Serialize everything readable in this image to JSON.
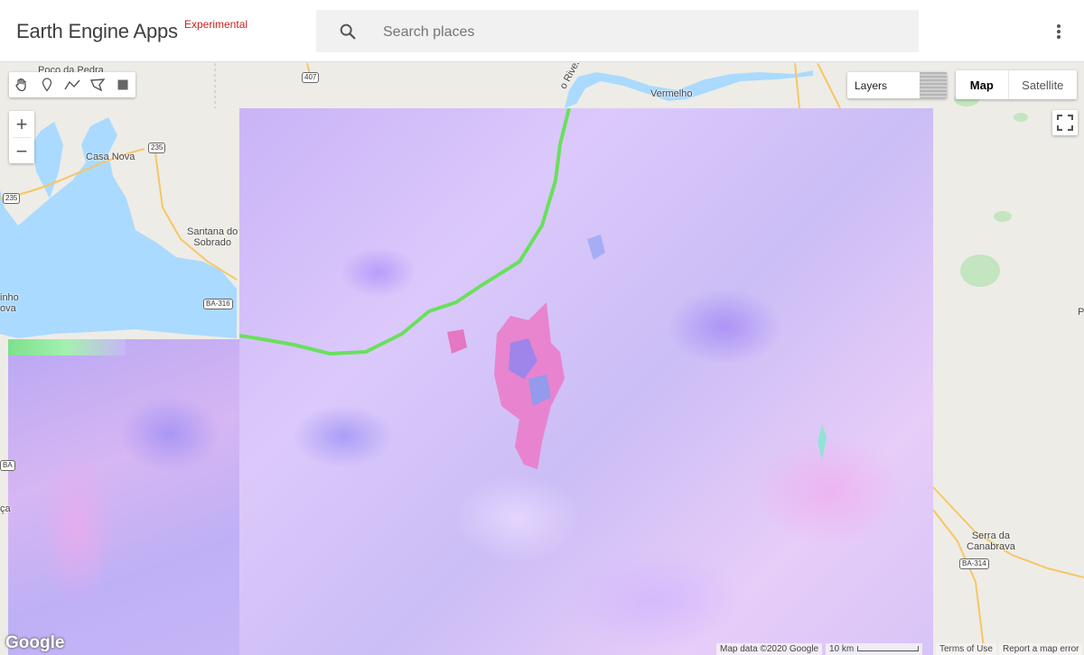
{
  "header": {
    "title": "Earth Engine Apps",
    "badge": "Experimental",
    "search_placeholder": "Search places"
  },
  "map": {
    "layers_label": "Layers",
    "maptype": [
      "Map",
      "Satellite"
    ],
    "zoom_in": "+",
    "zoom_out": "−",
    "labels": {
      "poco": "Poço da Pedra",
      "casa_nova": "Casa Nova",
      "santana": "Santana do\nSobrado",
      "vermelho": "Vermelho",
      "river": "o River",
      "inho": "inho\nova",
      "serra": "Serra da\nCanabrava",
      "edge_p": "P",
      "edge_ca": "ça"
    },
    "roads": {
      "r407": "407",
      "r235a": "235",
      "r235b": "235",
      "ba316": "BA-316",
      "ba314": "BA-314",
      "edge_ba": "BA"
    }
  },
  "footer": {
    "logo": "Google",
    "map_data": "Map data ©2020 Google",
    "scale": "10 km",
    "terms": "Terms of Use",
    "report": "Report a map error"
  },
  "colors": {
    "water": "#aadaff",
    "road": "#f6c766",
    "land": "#eeece6",
    "overlay": "#cbb8f6",
    "river_highlight": "#69e05c"
  }
}
